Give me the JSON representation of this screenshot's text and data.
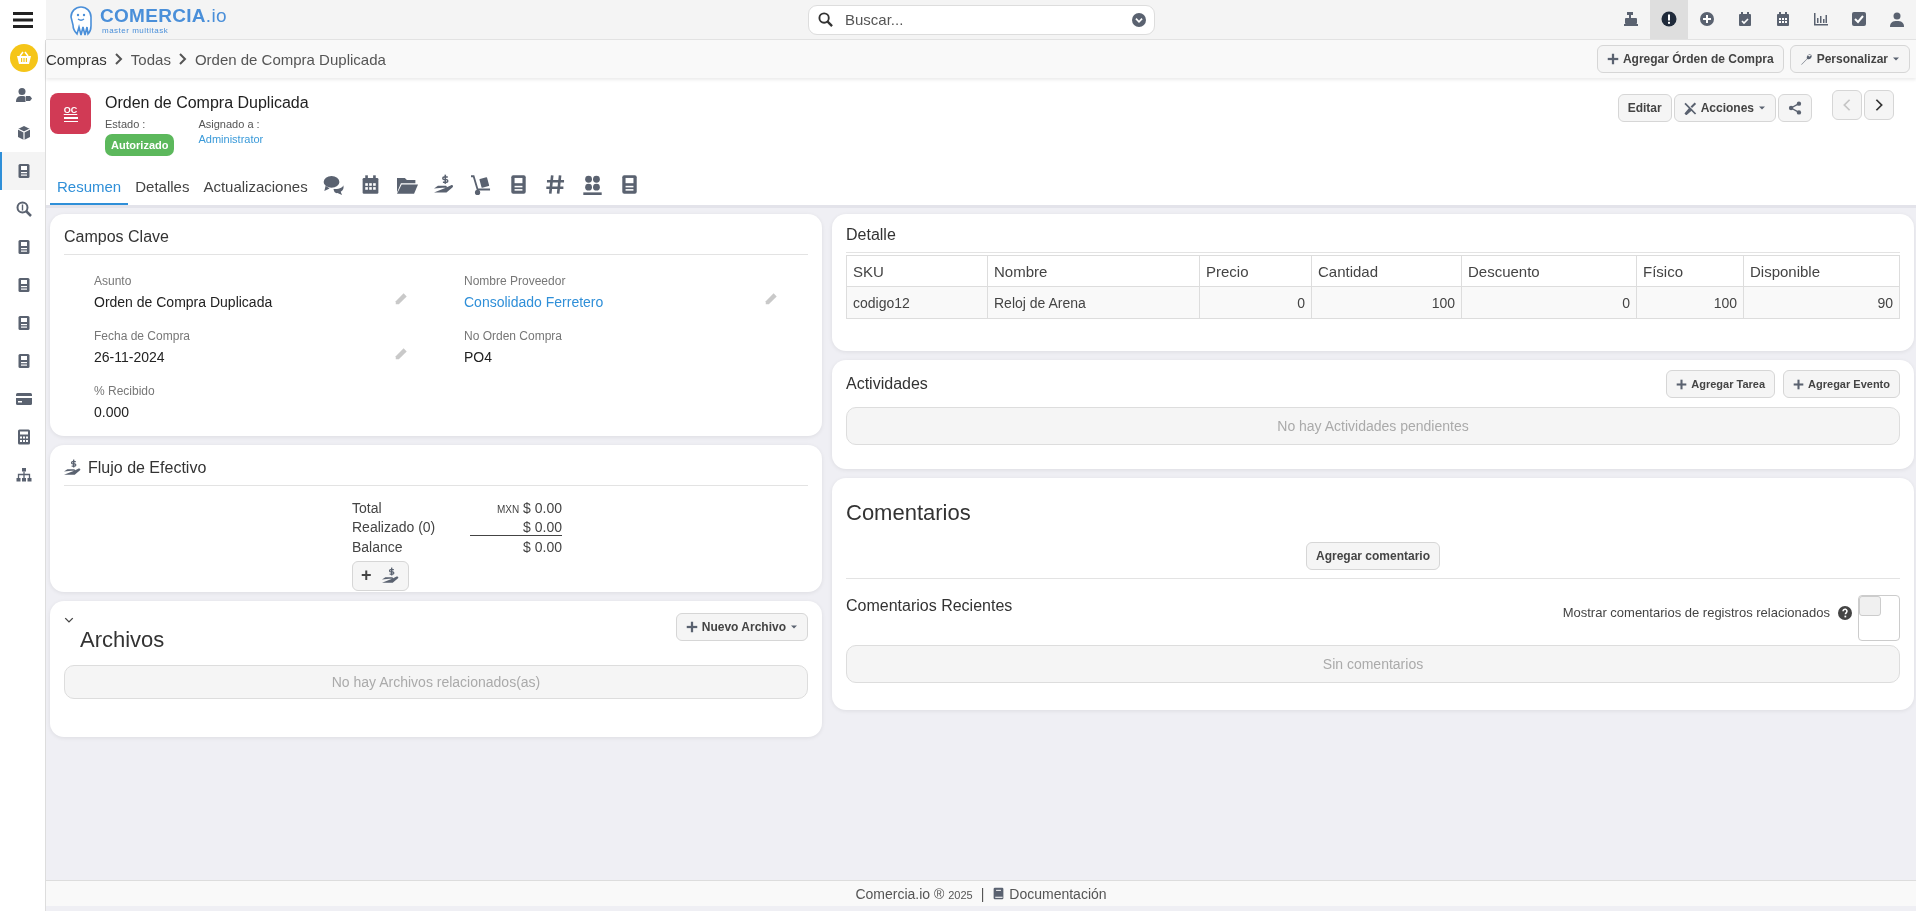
{
  "topbar": {
    "logo": {
      "name": "COMERCIA",
      "suffix": ".io",
      "tagline": "master multitask"
    },
    "search": {
      "placeholder": "Buscar..."
    },
    "icons": [
      {
        "kind": "register",
        "selected": false
      },
      {
        "kind": "alert",
        "selected": true
      },
      {
        "kind": "add",
        "selected": false
      },
      {
        "kind": "calendar-check",
        "selected": false
      },
      {
        "kind": "calendar",
        "selected": false
      },
      {
        "kind": "chart",
        "selected": false
      },
      {
        "kind": "check",
        "selected": false
      },
      {
        "kind": "user",
        "selected": false
      }
    ]
  },
  "sidebar": {
    "items": [
      {
        "kind": "basket",
        "selected": false
      },
      {
        "kind": "user-tag",
        "selected": false
      },
      {
        "kind": "box",
        "selected": false
      },
      {
        "kind": "doc",
        "selected": true
      },
      {
        "kind": "search-dollar",
        "selected": false
      },
      {
        "kind": "doc",
        "selected": false
      },
      {
        "kind": "doc",
        "selected": false
      },
      {
        "kind": "doc",
        "selected": false
      },
      {
        "kind": "doc",
        "selected": false
      },
      {
        "kind": "card",
        "selected": false
      },
      {
        "kind": "calculator",
        "selected": false
      },
      {
        "kind": "sitemap",
        "selected": false
      }
    ]
  },
  "breadcrumb": [
    "Compras",
    "Todas",
    "Orden de Compra Duplicada"
  ],
  "page_actions": [
    "Agregar Órden de Compra",
    "Personalizar"
  ],
  "record": {
    "icon_label": "OC",
    "title": "Orden de Compra Duplicada",
    "status_label": "Estado :",
    "status": "Autorizado",
    "assigned_label": "Asignado a :",
    "assigned_to": "Administrator",
    "actions": [
      "Editar",
      "Acciones"
    ]
  },
  "tabs": [
    {
      "kind": "text",
      "label": "Resumen",
      "selected": true
    },
    {
      "kind": "text",
      "label": "Detalles",
      "selected": false
    },
    {
      "kind": "text",
      "label": "Actualizaciones",
      "selected": false
    },
    {
      "kind": "comments",
      "selected": false
    },
    {
      "kind": "calendar",
      "selected": false
    },
    {
      "kind": "folder",
      "selected": false
    },
    {
      "kind": "hand-dollar",
      "selected": false
    },
    {
      "kind": "dolly",
      "selected": false
    },
    {
      "kind": "doc",
      "selected": false
    },
    {
      "kind": "hash",
      "selected": false
    },
    {
      "kind": "sat",
      "selected": false
    },
    {
      "kind": "doc",
      "selected": false
    }
  ],
  "key_fields": {
    "title": "Campos Clave",
    "fields": [
      {
        "label": "Asunto",
        "value": "Orden de Compra Duplicada",
        "kind": "text",
        "editable": true
      },
      {
        "label": "Nombre Proveedor",
        "value": "Consolidado Ferretero",
        "kind": "link",
        "editable": true
      },
      {
        "label": "Fecha de Compra",
        "value": "26-11-2024",
        "kind": "text",
        "editable": true
      },
      {
        "label": "No Orden Compra",
        "value": "PO4",
        "kind": "text",
        "editable": false
      },
      {
        "label": "% Recibido",
        "value": "0.000",
        "kind": "text",
        "editable": false
      }
    ]
  },
  "cash_flow": {
    "title": "Flujo de Efectivo",
    "rows": [
      {
        "label": "Total",
        "currency": "MXN",
        "value": "$ 0.00"
      },
      {
        "label": "Realizado (0)",
        "value": "$ 0.00"
      },
      {
        "label": "Balance",
        "value": "$ 0.00"
      }
    ],
    "add_button": "+"
  },
  "files": {
    "title": "Archivos",
    "expanded": true,
    "new_button": "Nuevo Archivo",
    "empty": "No hay Archivos relacionados(as)"
  },
  "detail": {
    "title": "Detalle",
    "columns": [
      "SKU",
      "Nombre",
      "Precio",
      "Cantidad",
      "Descuento",
      "Físico",
      "Disponible"
    ],
    "rows": [
      [
        "codigo12",
        "Reloj de Arena",
        "0",
        "100",
        "0",
        "100",
        "90"
      ]
    ]
  },
  "activities": {
    "title": "Actividades",
    "buttons": [
      "Agregar Tarea",
      "Agregar Evento"
    ],
    "empty": "No hay Actividades pendientes"
  },
  "comments": {
    "title": "Comentarios",
    "add_button": "Agregar comentario",
    "recent_title": "Comentarios Recientes",
    "related_label": "Mostrar comentarios de registros relacionados",
    "related_on": false,
    "empty": "Sin comentarios"
  },
  "footer": {
    "brand": "Comercia.io ®",
    "year": "2025",
    "separator": "|",
    "doc_link": "Documentación"
  }
}
